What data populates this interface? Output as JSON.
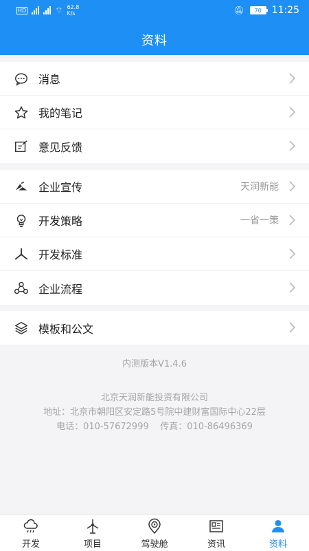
{
  "status_bar": {
    "left_tags": [
      "HD",
      "HD"
    ],
    "network_speed": "62.8 K/s",
    "battery": "70",
    "time": "11:25"
  },
  "header": {
    "title": "资料"
  },
  "groups": [
    {
      "items": [
        {
          "label": "消息",
          "value": "",
          "icon": "message-icon"
        },
        {
          "label": "我的笔记",
          "value": "",
          "icon": "star-icon"
        },
        {
          "label": "意见反馈",
          "value": "",
          "icon": "feedback-icon"
        }
      ]
    },
    {
      "items": [
        {
          "label": "企业宣传",
          "value": "天润新能",
          "icon": "company-logo-icon"
        },
        {
          "label": "开发策略",
          "value": "一省一策",
          "icon": "lightbulb-icon"
        },
        {
          "label": "开发标准",
          "value": "",
          "icon": "wind-turbine-icon"
        },
        {
          "label": "企业流程",
          "value": "",
          "icon": "flow-icon"
        }
      ]
    },
    {
      "items": [
        {
          "label": "模板和公文",
          "value": "",
          "icon": "layers-icon"
        }
      ]
    }
  ],
  "version": "内测版本V1.4.6",
  "company": {
    "name": "北京天润新能投资有限公司",
    "address": "地址：北京市朝阳区安定路5号院中建财富国际中心22层",
    "contact": "电话：010-57672999    传真：010-86496369"
  },
  "tabs": [
    {
      "label": "开发",
      "icon": "cloud-icon"
    },
    {
      "label": "项目",
      "icon": "turbine-icon"
    },
    {
      "label": "驾驶舱",
      "icon": "cockpit-icon"
    },
    {
      "label": "资讯",
      "icon": "news-icon"
    },
    {
      "label": "资料",
      "icon": "user-icon"
    }
  ],
  "colors": {
    "primary": "#1e90f5",
    "background": "#f4f4f6",
    "muted": "#a5a5a5"
  }
}
